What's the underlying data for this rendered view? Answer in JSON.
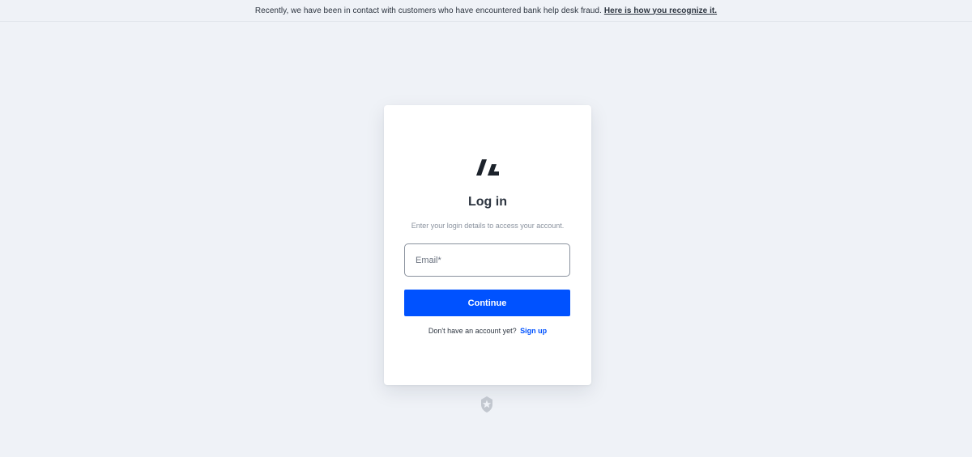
{
  "banner": {
    "text": "Recently, we have been in contact with customers who have encountered bank help desk fraud.",
    "link_text": "Here is how you recognize it."
  },
  "login": {
    "logo_icon": "brand-logo-icon",
    "title": "Log in",
    "subtitle": "Enter your login details to access your account.",
    "email_placeholder": "Email*",
    "email_value": "",
    "continue_label": "Continue",
    "signup_prompt": "Don't have an account yet?",
    "signup_link": "Sign up"
  },
  "footer": {
    "badge_icon": "shield-star-icon"
  },
  "colors": {
    "background": "#eff2f7",
    "accent": "#0052ff",
    "text": "#2d3540",
    "muted": "#8a929e"
  }
}
